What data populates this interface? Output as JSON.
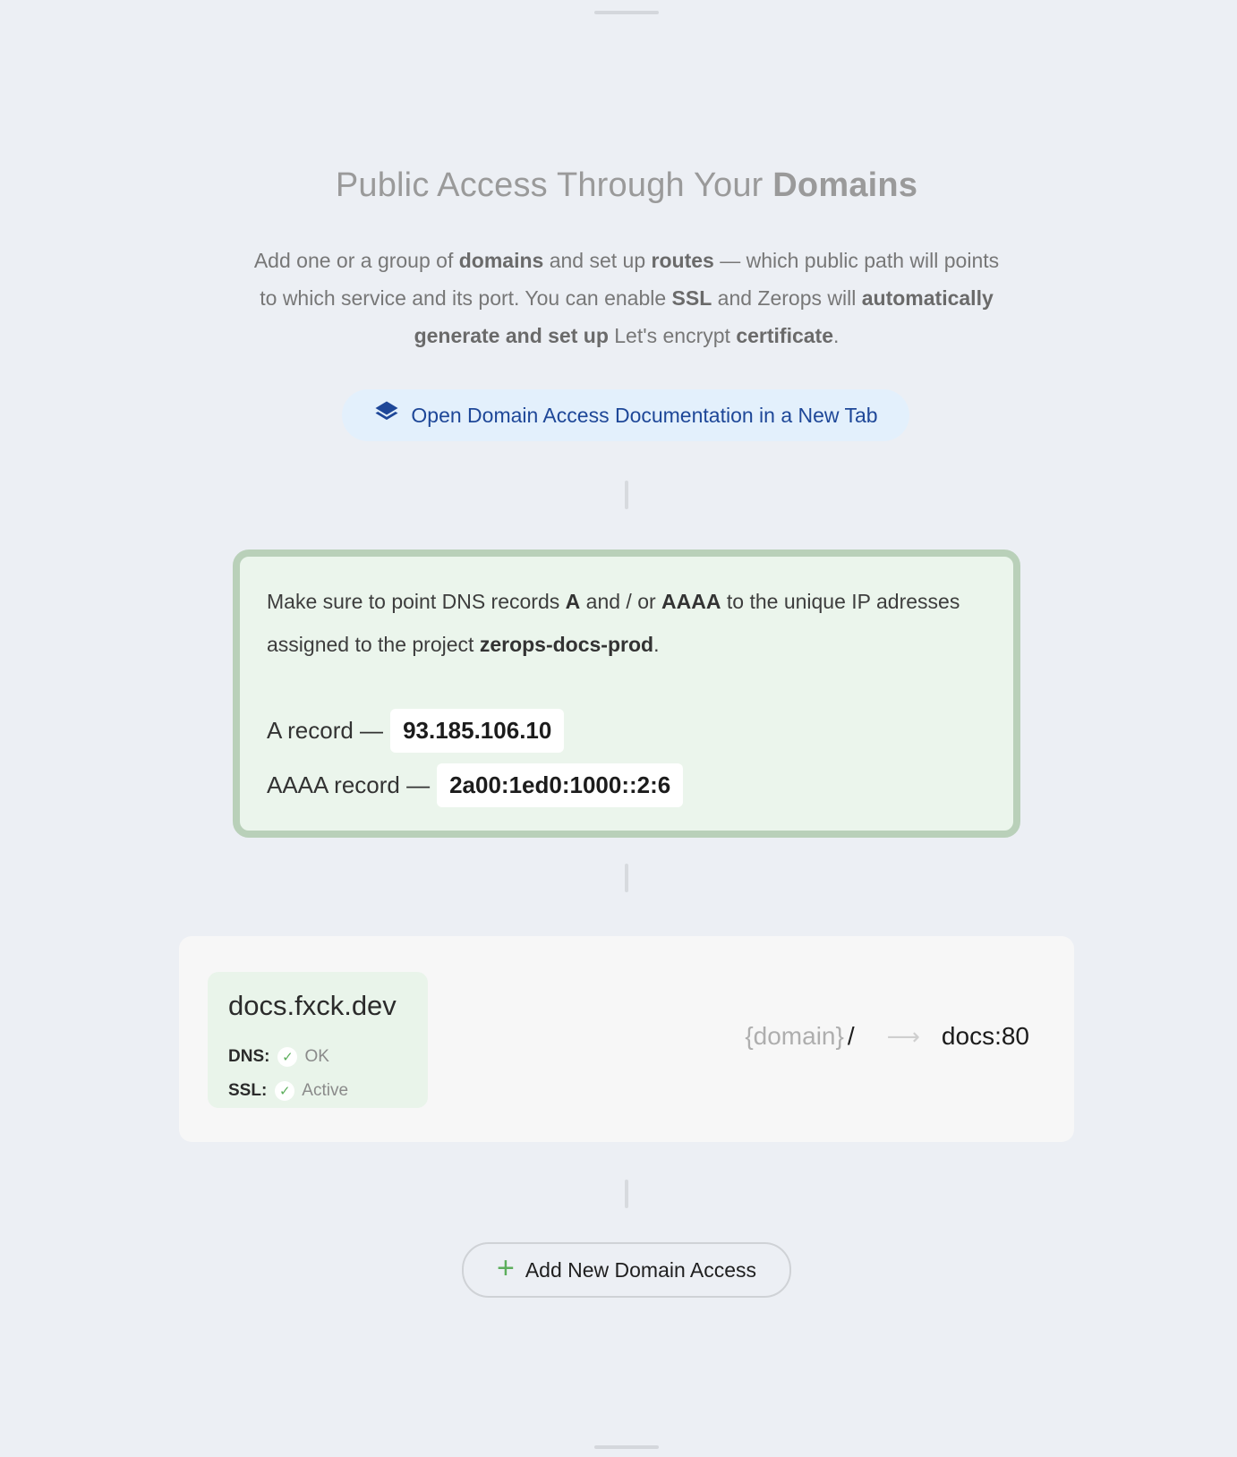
{
  "heading": {
    "title_plain": "Public Access Through Your ",
    "title_bold": "Domains"
  },
  "intro": {
    "p1": "Add one or a group of ",
    "b1": "domains",
    "p2": " and set up ",
    "b2": "routes",
    "p3": " — which public path will points to which service and its port. You can enable ",
    "b3": "SSL",
    "p4": " and Zerops will ",
    "b4": "automatically generate and set up",
    "p5": " Let's encrypt ",
    "b5": "certificate",
    "p6": "."
  },
  "docs_button": {
    "label": "Open Domain Access Documentation in a New Tab",
    "icon": "layers-icon",
    "color": "#1e4798"
  },
  "dns_notice": {
    "p1": "Make sure to point DNS records ",
    "b1": "A",
    "p2": " and / or ",
    "b2": "AAAA",
    "p3": " to the unique IP adresses assigned to the project ",
    "project": "zerops-docs-prod",
    "p4": ".",
    "a_record_label": "A record —",
    "a_record_value": "93.185.106.10",
    "aaaa_record_label": "AAAA record —",
    "aaaa_record_value": "2a00:1ed0:1000::2:6"
  },
  "domain_access": {
    "domain": "docs.fxck.dev",
    "dns_label": "DNS:",
    "dns_status": "OK",
    "ssl_label": "SSL:",
    "ssl_status": "Active",
    "route_pattern": "{domain}",
    "route_path": "/",
    "route_arrow_icon": "arrow-right-icon",
    "route_target": "docs:80",
    "status_color": "#5cae5c"
  },
  "add_button": {
    "label": "Add New Domain Access",
    "icon": "plus-icon"
  }
}
